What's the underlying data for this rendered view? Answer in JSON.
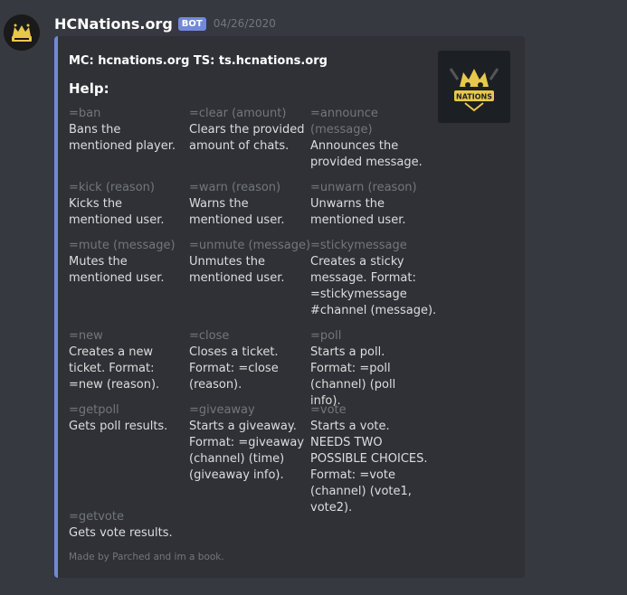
{
  "message": {
    "username": "HCNations.org",
    "bot_tag": "BOT",
    "timestamp": "04/26/2020"
  },
  "embed": {
    "accent_color": "#7289da",
    "author": "MC: hcnations.org TS: ts.hcnations.org",
    "title": "Help:",
    "thumbnail_text": "NATIONS",
    "fields": [
      {
        "name": "=ban",
        "value": "Bans the mentioned player."
      },
      {
        "name": "=clear (amount)",
        "value": "Clears the provided amount of chats."
      },
      {
        "name": "=announce (message)",
        "value": "Announces the provided message."
      },
      {
        "name": "=kick (reason)",
        "value": "Kicks the mentioned user."
      },
      {
        "name": "=warn (reason)",
        "value": "Warns the mentioned user."
      },
      {
        "name": "=unwarn (reason)",
        "value": "Unwarns the mentioned user."
      },
      {
        "name": "=mute (message)",
        "value": "Mutes the mentioned user."
      },
      {
        "name": "=unmute (message)",
        "value": "Unmutes the mentioned user."
      },
      {
        "name": "=stickymessage",
        "value": "Creates a sticky message. Format: =stickymessage #channel (message)."
      },
      {
        "name": "=new",
        "value": "Creates a new ticket. Format: =new (reason)."
      },
      {
        "name": "=close",
        "value": "Closes a ticket. Format: =close (reason)."
      },
      {
        "name": "=poll",
        "value": "Starts a poll. Format: =poll (channel) (poll info)."
      },
      {
        "name": "=getpoll",
        "value": "Gets poll results."
      },
      {
        "name": "=giveaway",
        "value": "Starts a giveaway. Format: =giveaway (channel) (time) (giveaway info)."
      },
      {
        "name": "=vote",
        "value": "Starts a vote. NEEDS TWO POSSIBLE CHOICES. Format: =vote (channel) (vote1, vote2)."
      },
      {
        "name": "=getvote",
        "value": "Gets vote results."
      }
    ],
    "footer": "Made by Parched and im a book."
  }
}
